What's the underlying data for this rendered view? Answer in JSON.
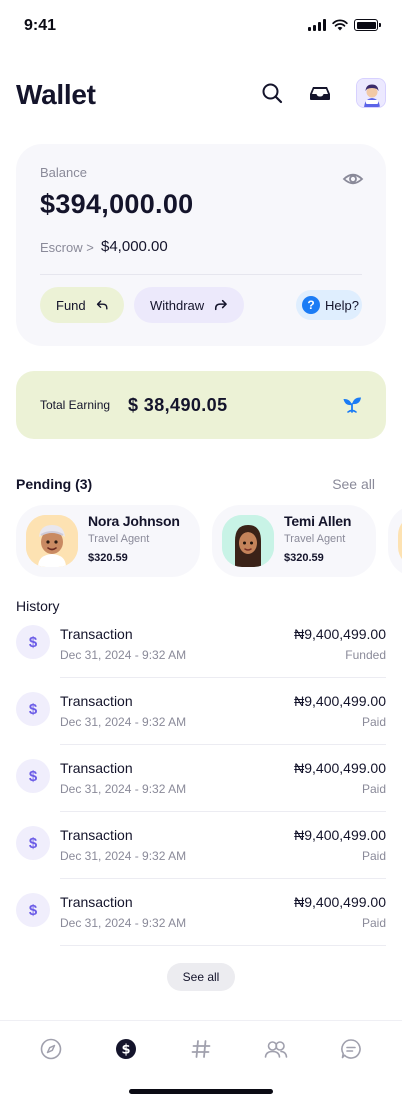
{
  "status_bar": {
    "time": "9:41"
  },
  "header": {
    "title": "Wallet"
  },
  "balance_card": {
    "label": "Balance",
    "amount": "$394,000.00",
    "escrow_label": "Escrow >",
    "escrow_amount": "$4,000.00",
    "fund_label": "Fund",
    "withdraw_label": "Withdraw",
    "help_label": "Help?"
  },
  "earning": {
    "label": "Total Earning",
    "amount": "$ 38,490.05"
  },
  "pending": {
    "title": "Pending (3)",
    "see_all": "See all",
    "items": [
      {
        "name": "Nora Johnson",
        "role": "Travel Agent",
        "amount": "$320.59"
      },
      {
        "name": "Temi Allen",
        "role": "Travel Agent",
        "amount": "$320.59"
      }
    ]
  },
  "history": {
    "title": "History",
    "items": [
      {
        "icon": "$",
        "title": "Transaction",
        "date": "Dec 31, 2024 - 9:32 AM",
        "amount": "₦9,400,499.00",
        "status": "Funded"
      },
      {
        "icon": "$",
        "title": "Transaction",
        "date": "Dec 31, 2024 - 9:32 AM",
        "amount": "₦9,400,499.00",
        "status": "Paid"
      },
      {
        "icon": "$",
        "title": "Transaction",
        "date": "Dec 31, 2024 - 9:32 AM",
        "amount": "₦9,400,499.00",
        "status": "Paid"
      },
      {
        "icon": "$",
        "title": "Transaction",
        "date": "Dec 31, 2024 - 9:32 AM",
        "amount": "₦9,400,499.00",
        "status": "Paid"
      },
      {
        "icon": "$",
        "title": "Transaction",
        "date": "Dec 31, 2024 - 9:32 AM",
        "amount": "₦9,400,499.00",
        "status": "Paid"
      }
    ],
    "see_all": "See all"
  },
  "tab_bar": {
    "tabs": [
      {
        "icon": "compass-icon",
        "active": false
      },
      {
        "icon": "dollar-icon",
        "active": true
      },
      {
        "icon": "hashtag-icon",
        "active": false
      },
      {
        "icon": "users-icon",
        "active": false
      },
      {
        "icon": "chat-icon",
        "active": false
      }
    ]
  },
  "colors": {
    "ink": "#14142b",
    "muted": "#8a8a99",
    "card_bg": "#f7f7fb",
    "earning_bg": "#ecf2d6",
    "accent_purple": "#6b5ce7",
    "help_blue": "#1b7cf5"
  }
}
